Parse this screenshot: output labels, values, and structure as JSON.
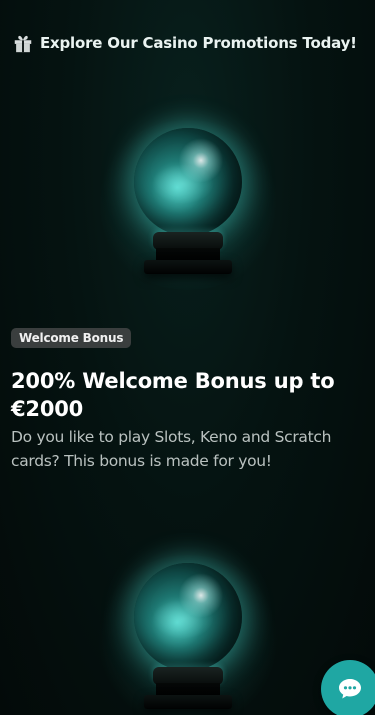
{
  "header": {
    "icon": "gift-icon",
    "title": "Explore Our Casino Promotions Today!"
  },
  "promotions": [
    {
      "image": "crystal-ball",
      "badge": "Welcome Bonus",
      "title": "200% Welcome Bonus up to €2000",
      "description": "Do you like to play Slots, Keno and Scratch cards? This bonus is made for you!"
    },
    {
      "image": "crystal-ball"
    }
  ],
  "chat": {
    "icon": "chat-bubble-icon"
  },
  "colors": {
    "background": "#040d0c",
    "accent": "#1fa7a3",
    "badge_bg": "#3a3e3e",
    "text": "#ffffff",
    "muted_text": "#b9c1bf"
  }
}
